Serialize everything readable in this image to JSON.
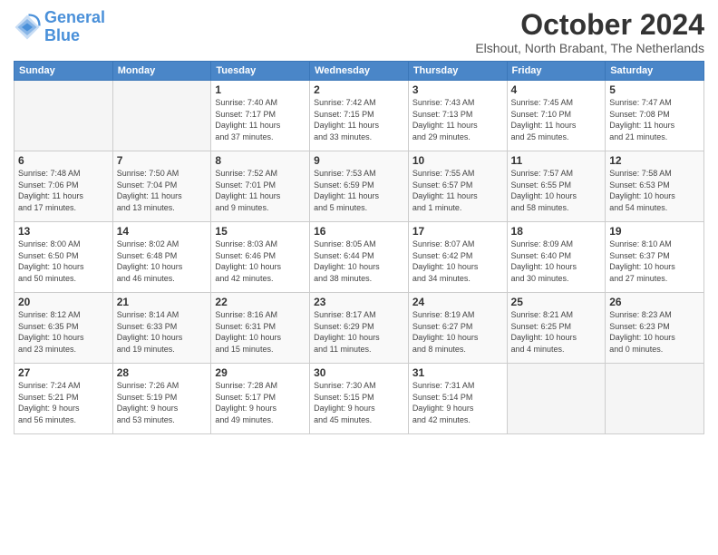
{
  "logo": {
    "line1": "General",
    "line2": "Blue"
  },
  "header": {
    "month": "October 2024",
    "location": "Elshout, North Brabant, The Netherlands"
  },
  "weekdays": [
    "Sunday",
    "Monday",
    "Tuesday",
    "Wednesday",
    "Thursday",
    "Friday",
    "Saturday"
  ],
  "weeks": [
    [
      {
        "day": "",
        "info": ""
      },
      {
        "day": "",
        "info": ""
      },
      {
        "day": "1",
        "info": "Sunrise: 7:40 AM\nSunset: 7:17 PM\nDaylight: 11 hours\nand 37 minutes."
      },
      {
        "day": "2",
        "info": "Sunrise: 7:42 AM\nSunset: 7:15 PM\nDaylight: 11 hours\nand 33 minutes."
      },
      {
        "day": "3",
        "info": "Sunrise: 7:43 AM\nSunset: 7:13 PM\nDaylight: 11 hours\nand 29 minutes."
      },
      {
        "day": "4",
        "info": "Sunrise: 7:45 AM\nSunset: 7:10 PM\nDaylight: 11 hours\nand 25 minutes."
      },
      {
        "day": "5",
        "info": "Sunrise: 7:47 AM\nSunset: 7:08 PM\nDaylight: 11 hours\nand 21 minutes."
      }
    ],
    [
      {
        "day": "6",
        "info": "Sunrise: 7:48 AM\nSunset: 7:06 PM\nDaylight: 11 hours\nand 17 minutes."
      },
      {
        "day": "7",
        "info": "Sunrise: 7:50 AM\nSunset: 7:04 PM\nDaylight: 11 hours\nand 13 minutes."
      },
      {
        "day": "8",
        "info": "Sunrise: 7:52 AM\nSunset: 7:01 PM\nDaylight: 11 hours\nand 9 minutes."
      },
      {
        "day": "9",
        "info": "Sunrise: 7:53 AM\nSunset: 6:59 PM\nDaylight: 11 hours\nand 5 minutes."
      },
      {
        "day": "10",
        "info": "Sunrise: 7:55 AM\nSunset: 6:57 PM\nDaylight: 11 hours\nand 1 minute."
      },
      {
        "day": "11",
        "info": "Sunrise: 7:57 AM\nSunset: 6:55 PM\nDaylight: 10 hours\nand 58 minutes."
      },
      {
        "day": "12",
        "info": "Sunrise: 7:58 AM\nSunset: 6:53 PM\nDaylight: 10 hours\nand 54 minutes."
      }
    ],
    [
      {
        "day": "13",
        "info": "Sunrise: 8:00 AM\nSunset: 6:50 PM\nDaylight: 10 hours\nand 50 minutes."
      },
      {
        "day": "14",
        "info": "Sunrise: 8:02 AM\nSunset: 6:48 PM\nDaylight: 10 hours\nand 46 minutes."
      },
      {
        "day": "15",
        "info": "Sunrise: 8:03 AM\nSunset: 6:46 PM\nDaylight: 10 hours\nand 42 minutes."
      },
      {
        "day": "16",
        "info": "Sunrise: 8:05 AM\nSunset: 6:44 PM\nDaylight: 10 hours\nand 38 minutes."
      },
      {
        "day": "17",
        "info": "Sunrise: 8:07 AM\nSunset: 6:42 PM\nDaylight: 10 hours\nand 34 minutes."
      },
      {
        "day": "18",
        "info": "Sunrise: 8:09 AM\nSunset: 6:40 PM\nDaylight: 10 hours\nand 30 minutes."
      },
      {
        "day": "19",
        "info": "Sunrise: 8:10 AM\nSunset: 6:37 PM\nDaylight: 10 hours\nand 27 minutes."
      }
    ],
    [
      {
        "day": "20",
        "info": "Sunrise: 8:12 AM\nSunset: 6:35 PM\nDaylight: 10 hours\nand 23 minutes."
      },
      {
        "day": "21",
        "info": "Sunrise: 8:14 AM\nSunset: 6:33 PM\nDaylight: 10 hours\nand 19 minutes."
      },
      {
        "day": "22",
        "info": "Sunrise: 8:16 AM\nSunset: 6:31 PM\nDaylight: 10 hours\nand 15 minutes."
      },
      {
        "day": "23",
        "info": "Sunrise: 8:17 AM\nSunset: 6:29 PM\nDaylight: 10 hours\nand 11 minutes."
      },
      {
        "day": "24",
        "info": "Sunrise: 8:19 AM\nSunset: 6:27 PM\nDaylight: 10 hours\nand 8 minutes."
      },
      {
        "day": "25",
        "info": "Sunrise: 8:21 AM\nSunset: 6:25 PM\nDaylight: 10 hours\nand 4 minutes."
      },
      {
        "day": "26",
        "info": "Sunrise: 8:23 AM\nSunset: 6:23 PM\nDaylight: 10 hours\nand 0 minutes."
      }
    ],
    [
      {
        "day": "27",
        "info": "Sunrise: 7:24 AM\nSunset: 5:21 PM\nDaylight: 9 hours\nand 56 minutes."
      },
      {
        "day": "28",
        "info": "Sunrise: 7:26 AM\nSunset: 5:19 PM\nDaylight: 9 hours\nand 53 minutes."
      },
      {
        "day": "29",
        "info": "Sunrise: 7:28 AM\nSunset: 5:17 PM\nDaylight: 9 hours\nand 49 minutes."
      },
      {
        "day": "30",
        "info": "Sunrise: 7:30 AM\nSunset: 5:15 PM\nDaylight: 9 hours\nand 45 minutes."
      },
      {
        "day": "31",
        "info": "Sunrise: 7:31 AM\nSunset: 5:14 PM\nDaylight: 9 hours\nand 42 minutes."
      },
      {
        "day": "",
        "info": ""
      },
      {
        "day": "",
        "info": ""
      }
    ]
  ]
}
